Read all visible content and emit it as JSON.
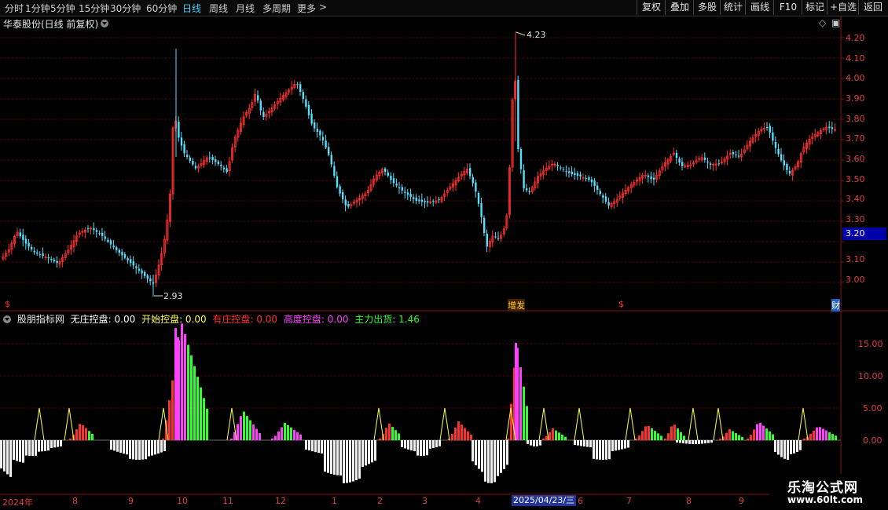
{
  "toolbar": {
    "periods": [
      "分时",
      "1分钟",
      "5分钟",
      "15分钟",
      "30分钟",
      "60分钟",
      "日线",
      "周线",
      "月线",
      "多周期",
      "更多"
    ],
    "active_period": "日线",
    "more_arrow": ">",
    "right_buttons": [
      "复权",
      "叠加",
      "多股",
      "统计",
      "画线",
      "F10",
      "标记",
      "+自选",
      "返回"
    ]
  },
  "chart_title": "华泰股份(日线 前复权)",
  "current_price": "3.20",
  "price_axis": [
    "4.20",
    "4.10",
    "4.00",
    "3.90",
    "3.80",
    "3.70",
    "3.60",
    "3.50",
    "3.40",
    "3.30",
    "3.10",
    "3.00"
  ],
  "annotations": {
    "high": "4.23",
    "low": "2.93"
  },
  "events": [
    {
      "label": "$",
      "color": "#ff3030"
    },
    {
      "label": "增发",
      "color": "#ffd040"
    },
    {
      "label": "$",
      "color": "#ff3030"
    },
    {
      "label": "财",
      "color": "#40a0ff"
    }
  ],
  "indicator": {
    "name": "股朋指标网",
    "series": [
      {
        "label": "无庄控盘: 0.00",
        "color": "#ffffff"
      },
      {
        "label": "开始控盘: 0.00",
        "color": "#ffff40"
      },
      {
        "label": "有庄控盘: 0.00",
        "color": "#ff3030"
      },
      {
        "label": "高度控盘: 0.00",
        "color": "#ff40ff"
      },
      {
        "label": "主力出货: 1.46",
        "color": "#30ff30"
      }
    ],
    "axis": [
      "15.00",
      "10.00",
      "5.00",
      "0.00"
    ]
  },
  "date_axis": [
    "2024年",
    "8",
    "9",
    "10",
    "11",
    "12",
    "1",
    "2",
    "3",
    "4",
    "6",
    "7",
    "8",
    "9"
  ],
  "date_highlight": "2025/04/23/三",
  "watermark": {
    "title": "乐淘公式网",
    "url": "www.60lt.com"
  },
  "colors": {
    "up": "#ff3030",
    "down": "#54e0ff",
    "grid": "#6b0000"
  }
}
